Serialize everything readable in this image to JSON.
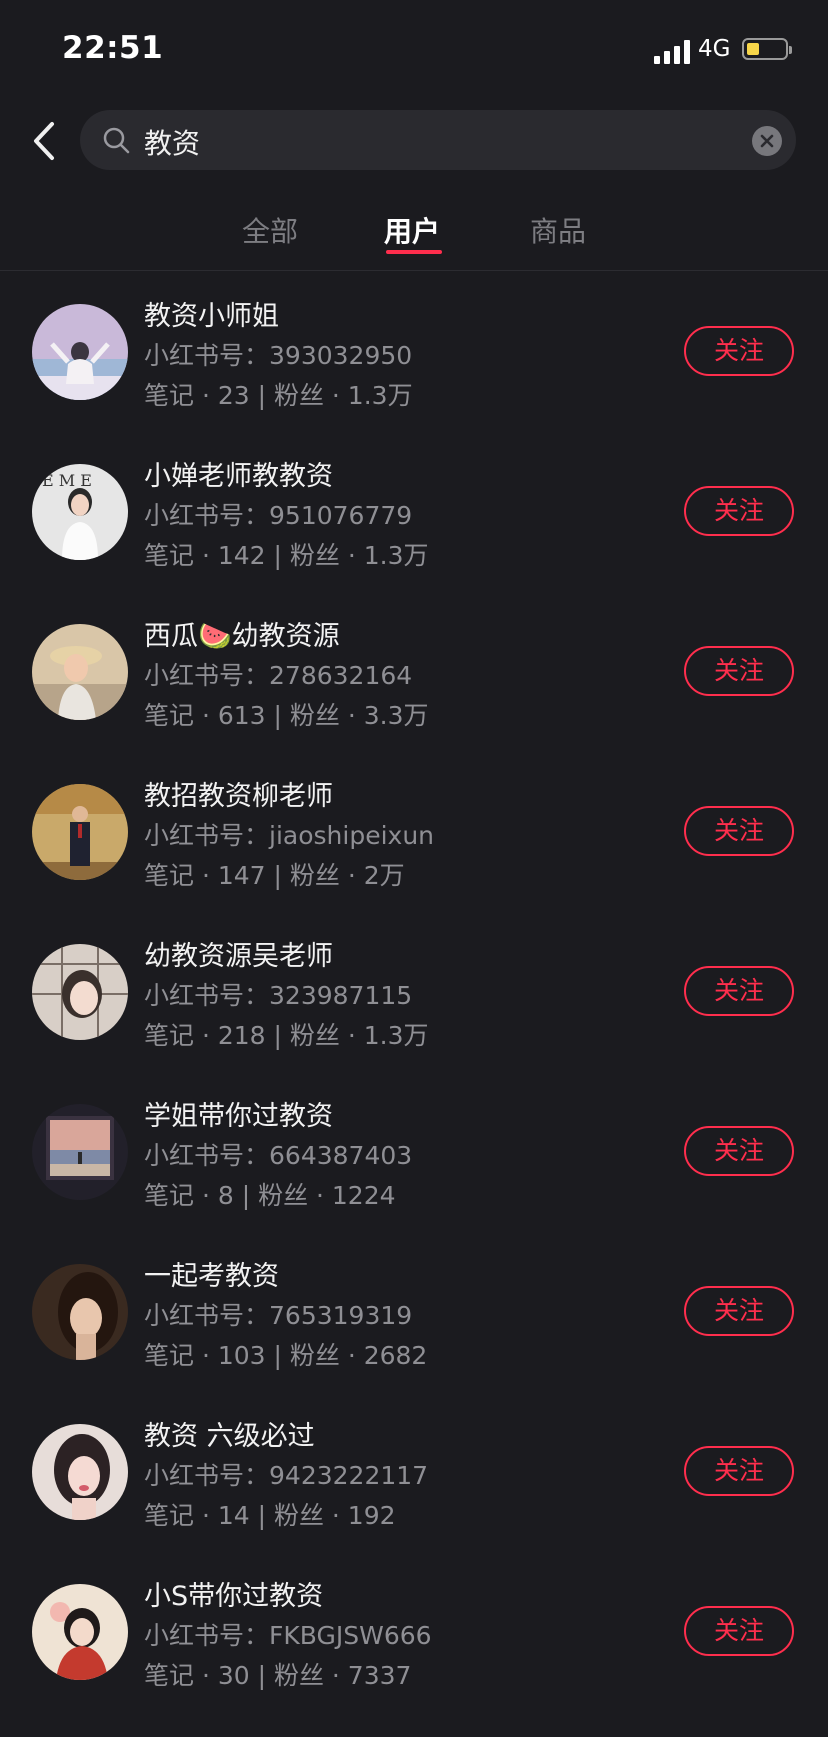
{
  "status_bar": {
    "time": "22:51",
    "network": "4G",
    "battery_icon": "battery-icon",
    "signal_icon": "signal-icon"
  },
  "search": {
    "query": "教资",
    "search_icon": "search-icon",
    "clear_icon": "clear-icon",
    "back_icon": "back-icon"
  },
  "tabs": [
    {
      "label": "全部",
      "active": false
    },
    {
      "label": "用户",
      "active": true
    },
    {
      "label": "商品",
      "active": false
    }
  ],
  "users": [
    {
      "name": "教资小师姐",
      "id_label": "小红书号：",
      "id": "393032950",
      "stats": "笔记 · 23 | 粉丝 · 1.3万",
      "follow": "关注"
    },
    {
      "name": "小婵老师教教资",
      "id_label": "小红书号：",
      "id": "951076779",
      "stats": "笔记 · 142 | 粉丝 · 1.3万",
      "follow": "关注"
    },
    {
      "name": "西瓜🍉幼教资源",
      "id_label": "小红书号：",
      "id": "278632164",
      "stats": "笔记 · 613 | 粉丝 · 3.3万",
      "follow": "关注"
    },
    {
      "name": "教招教资柳老师",
      "id_label": "小红书号：",
      "id": "jiaoshipeixun",
      "stats": "笔记 · 147 | 粉丝 · 2万",
      "follow": "关注"
    },
    {
      "name": "幼教资源吴老师",
      "id_label": "小红书号：",
      "id": "323987115",
      "stats": "笔记 · 218 | 粉丝 · 1.3万",
      "follow": "关注"
    },
    {
      "name": "学姐带你过教资",
      "id_label": "小红书号：",
      "id": "664387403",
      "stats": "笔记 · 8 | 粉丝 · 1224",
      "follow": "关注"
    },
    {
      "name": "一起考教资",
      "id_label": "小红书号：",
      "id": "765319319",
      "stats": "笔记 · 103 | 粉丝 · 2682",
      "follow": "关注"
    },
    {
      "name": "教资 六级必过",
      "id_label": "小红书号：",
      "id": "9423222117",
      "stats": "笔记 · 14 | 粉丝 · 192",
      "follow": "关注"
    },
    {
      "name": "小S带你过教资",
      "id_label": "小红书号：",
      "id": "FKBGJSW666",
      "stats": "笔记 · 30 | 粉丝 · 7337",
      "follow": "关注"
    }
  ],
  "colors": {
    "background": "#1b1b1f",
    "accent": "#ff2e4d",
    "battery": "#f7d64a"
  }
}
